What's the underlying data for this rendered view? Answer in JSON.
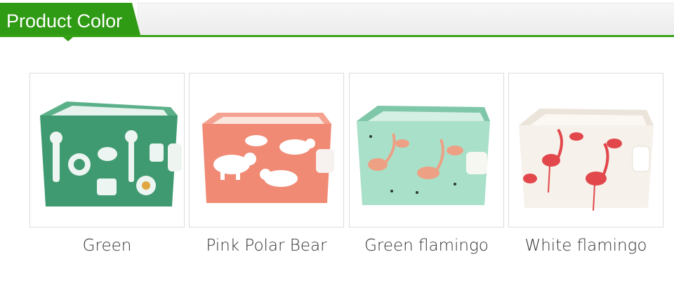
{
  "header": {
    "title": "Product Color"
  },
  "products": [
    {
      "label": "Green",
      "color": "#3f9a71",
      "accent": "#ffffff"
    },
    {
      "label": "Pink Polar Bear",
      "color": "#f08a74",
      "accent": "#ffffff"
    },
    {
      "label": "Green flamingo",
      "color": "#a9e0c9",
      "accent": "#f59a7c"
    },
    {
      "label": "White flamingo",
      "color": "#f6f1ea",
      "accent": "#e2474b"
    }
  ]
}
